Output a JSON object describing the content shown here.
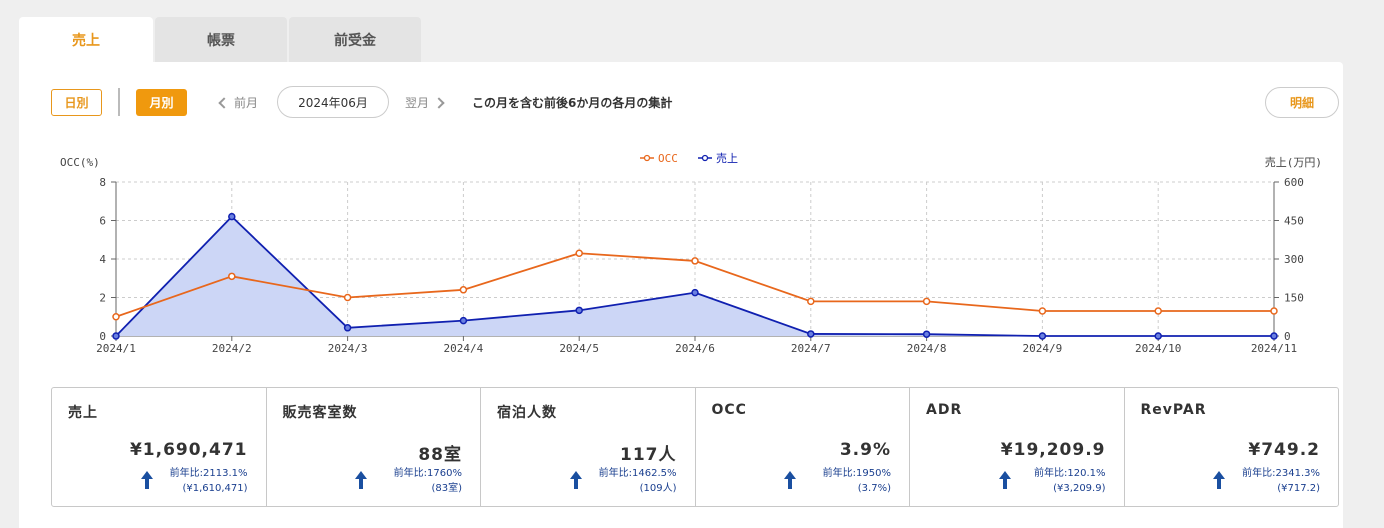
{
  "tabs": [
    {
      "label": "売上",
      "active": true
    },
    {
      "label": "帳票",
      "active": false
    },
    {
      "label": "前受金",
      "active": false
    }
  ],
  "toolbar": {
    "day_label": "日別",
    "month_label": "月別",
    "prev_label": "前月",
    "current_month": "2024年06月",
    "next_label": "翌月",
    "description": "この月を含む前後6か月の各月の集計",
    "detail_label": "明細"
  },
  "chart_data": {
    "type": "line",
    "categories": [
      "2024/1",
      "2024/2",
      "2024/3",
      "2024/4",
      "2024/5",
      "2024/6",
      "2024/7",
      "2024/8",
      "2024/9",
      "2024/10",
      "2024/11"
    ],
    "series": [
      {
        "name": "OCC",
        "axis": "left",
        "color": "#e8671c",
        "values": [
          1.0,
          3.1,
          2.0,
          2.4,
          4.3,
          3.9,
          1.8,
          1.8,
          1.3,
          1.3,
          1.3
        ]
      },
      {
        "name": "売上",
        "axis": "right",
        "color": "#1020b0",
        "fill": "#ccd6f6",
        "values": [
          0,
          465,
          32,
          60,
          100,
          169,
          8,
          7,
          0,
          0,
          0
        ]
      }
    ],
    "ylabel_left": "OCC(%)",
    "ylabel_right": "売上(万円)",
    "ylim_left": [
      0,
      8
    ],
    "ylim_right": [
      0,
      600
    ],
    "yticks_left": [
      "0",
      "2",
      "4",
      "6",
      "8"
    ],
    "yticks_right": [
      "0",
      "150",
      "300",
      "450",
      "600"
    ],
    "legend_position": "top-center",
    "grid": true
  },
  "stats": [
    {
      "label": "売上",
      "value": "¥1,690,471",
      "compare": "前年比:2113.1%",
      "prev": "(¥1,610,471)"
    },
    {
      "label": "販売客室数",
      "value": "88室",
      "compare": "前年比:1760%",
      "prev": "(83室)"
    },
    {
      "label": "宿泊人数",
      "value": "117人",
      "compare": "前年比:1462.5%",
      "prev": "(109人)"
    },
    {
      "label": "OCC",
      "value": "3.9%",
      "compare": "前年比:1950%",
      "prev": "(3.7%)"
    },
    {
      "label": "ADR",
      "value": "¥19,209.9",
      "compare": "前年比:120.1%",
      "prev": "(¥3,209.9)"
    },
    {
      "label": "RevPAR",
      "value": "¥749.2",
      "compare": "前年比:2341.3%",
      "prev": "(¥717.2)"
    }
  ],
  "colors": {
    "accent": "#f0990e",
    "up_arrow": "#1a4fa0"
  }
}
